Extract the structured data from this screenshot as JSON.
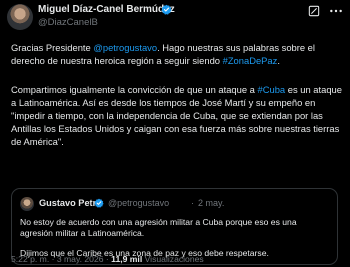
{
  "author": {
    "name": "Miguel Díaz-Canel Bermúdez",
    "handle": "@DiazCanelB"
  },
  "tweet": {
    "p1": [
      {
        "text": "Gracias Presidente ",
        "link": false
      },
      {
        "text": "@petrogustavo",
        "link": true
      },
      {
        "text": ". Hago nuestras sus palabras sobre el derecho de nuestra heroica región a seguir siendo ",
        "link": false
      },
      {
        "text": "#ZonaDePaz",
        "link": true
      },
      {
        "text": ".",
        "link": false
      }
    ],
    "p2": [
      {
        "text": "Compartimos igualmente la convicción de que un ataque a ",
        "link": false
      },
      {
        "text": "#Cuba",
        "link": true
      },
      {
        "text": " es un ataque a Latinoamérica. Así es desde los tiempos de José Martí y su empeño en  \"impedir a tiempo, con la independencia de Cuba, que se extiendan por las Antillas los Estados Unidos y caigan con esa fuerza más sobre nuestras tierras de América\".",
        "link": false
      }
    ]
  },
  "quote": {
    "name": "Gustavo Petro",
    "handle": "@petrogustavo",
    "separator": "·",
    "date": "2 may.",
    "p1": "No estoy de acuerdo con una agresión militar a Cuba porque eso es una agresión militar a Latinoamérica.",
    "p2": "Dijimos que el Caribe es una zona de paz y eso debe respetarse.",
    "ellipsis": "..."
  },
  "meta": {
    "time_date": "5:22 p. m. · 3 may. 2026 · ",
    "views_count": "11,9 mil",
    "views_label": " Visualizaciones"
  },
  "colors": {
    "background": "#000000",
    "text": "#e7e9ea",
    "secondary": "#71767b",
    "link": "#1d9bf0",
    "verified_badge": "#1d9bf0",
    "border": "#2f3336"
  },
  "icons": [
    "verified-badge-icon",
    "grok-icon",
    "more-options-icon"
  ]
}
